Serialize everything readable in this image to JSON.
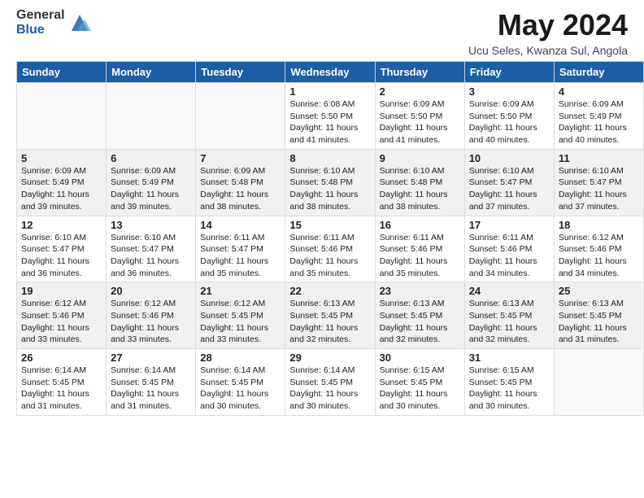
{
  "logo": {
    "general": "General",
    "blue": "Blue"
  },
  "title": "May 2024",
  "location": "Ucu Seles, Kwanza Sul, Angola",
  "days_of_week": [
    "Sunday",
    "Monday",
    "Tuesday",
    "Wednesday",
    "Thursday",
    "Friday",
    "Saturday"
  ],
  "weeks": [
    [
      {
        "day": "",
        "info": ""
      },
      {
        "day": "",
        "info": ""
      },
      {
        "day": "",
        "info": ""
      },
      {
        "day": "1",
        "info": "Sunrise: 6:08 AM\nSunset: 5:50 PM\nDaylight: 11 hours and 41 minutes."
      },
      {
        "day": "2",
        "info": "Sunrise: 6:09 AM\nSunset: 5:50 PM\nDaylight: 11 hours and 41 minutes."
      },
      {
        "day": "3",
        "info": "Sunrise: 6:09 AM\nSunset: 5:50 PM\nDaylight: 11 hours and 40 minutes."
      },
      {
        "day": "4",
        "info": "Sunrise: 6:09 AM\nSunset: 5:49 PM\nDaylight: 11 hours and 40 minutes."
      }
    ],
    [
      {
        "day": "5",
        "info": "Sunrise: 6:09 AM\nSunset: 5:49 PM\nDaylight: 11 hours and 39 minutes."
      },
      {
        "day": "6",
        "info": "Sunrise: 6:09 AM\nSunset: 5:49 PM\nDaylight: 11 hours and 39 minutes."
      },
      {
        "day": "7",
        "info": "Sunrise: 6:09 AM\nSunset: 5:48 PM\nDaylight: 11 hours and 38 minutes."
      },
      {
        "day": "8",
        "info": "Sunrise: 6:10 AM\nSunset: 5:48 PM\nDaylight: 11 hours and 38 minutes."
      },
      {
        "day": "9",
        "info": "Sunrise: 6:10 AM\nSunset: 5:48 PM\nDaylight: 11 hours and 38 minutes."
      },
      {
        "day": "10",
        "info": "Sunrise: 6:10 AM\nSunset: 5:47 PM\nDaylight: 11 hours and 37 minutes."
      },
      {
        "day": "11",
        "info": "Sunrise: 6:10 AM\nSunset: 5:47 PM\nDaylight: 11 hours and 37 minutes."
      }
    ],
    [
      {
        "day": "12",
        "info": "Sunrise: 6:10 AM\nSunset: 5:47 PM\nDaylight: 11 hours and 36 minutes."
      },
      {
        "day": "13",
        "info": "Sunrise: 6:10 AM\nSunset: 5:47 PM\nDaylight: 11 hours and 36 minutes."
      },
      {
        "day": "14",
        "info": "Sunrise: 6:11 AM\nSunset: 5:47 PM\nDaylight: 11 hours and 35 minutes."
      },
      {
        "day": "15",
        "info": "Sunrise: 6:11 AM\nSunset: 5:46 PM\nDaylight: 11 hours and 35 minutes."
      },
      {
        "day": "16",
        "info": "Sunrise: 6:11 AM\nSunset: 5:46 PM\nDaylight: 11 hours and 35 minutes."
      },
      {
        "day": "17",
        "info": "Sunrise: 6:11 AM\nSunset: 5:46 PM\nDaylight: 11 hours and 34 minutes."
      },
      {
        "day": "18",
        "info": "Sunrise: 6:12 AM\nSunset: 5:46 PM\nDaylight: 11 hours and 34 minutes."
      }
    ],
    [
      {
        "day": "19",
        "info": "Sunrise: 6:12 AM\nSunset: 5:46 PM\nDaylight: 11 hours and 33 minutes."
      },
      {
        "day": "20",
        "info": "Sunrise: 6:12 AM\nSunset: 5:46 PM\nDaylight: 11 hours and 33 minutes."
      },
      {
        "day": "21",
        "info": "Sunrise: 6:12 AM\nSunset: 5:45 PM\nDaylight: 11 hours and 33 minutes."
      },
      {
        "day": "22",
        "info": "Sunrise: 6:13 AM\nSunset: 5:45 PM\nDaylight: 11 hours and 32 minutes."
      },
      {
        "day": "23",
        "info": "Sunrise: 6:13 AM\nSunset: 5:45 PM\nDaylight: 11 hours and 32 minutes."
      },
      {
        "day": "24",
        "info": "Sunrise: 6:13 AM\nSunset: 5:45 PM\nDaylight: 11 hours and 32 minutes."
      },
      {
        "day": "25",
        "info": "Sunrise: 6:13 AM\nSunset: 5:45 PM\nDaylight: 11 hours and 31 minutes."
      }
    ],
    [
      {
        "day": "26",
        "info": "Sunrise: 6:14 AM\nSunset: 5:45 PM\nDaylight: 11 hours and 31 minutes."
      },
      {
        "day": "27",
        "info": "Sunrise: 6:14 AM\nSunset: 5:45 PM\nDaylight: 11 hours and 31 minutes."
      },
      {
        "day": "28",
        "info": "Sunrise: 6:14 AM\nSunset: 5:45 PM\nDaylight: 11 hours and 30 minutes."
      },
      {
        "day": "29",
        "info": "Sunrise: 6:14 AM\nSunset: 5:45 PM\nDaylight: 11 hours and 30 minutes."
      },
      {
        "day": "30",
        "info": "Sunrise: 6:15 AM\nSunset: 5:45 PM\nDaylight: 11 hours and 30 minutes."
      },
      {
        "day": "31",
        "info": "Sunrise: 6:15 AM\nSunset: 5:45 PM\nDaylight: 11 hours and 30 minutes."
      },
      {
        "day": "",
        "info": ""
      }
    ]
  ]
}
